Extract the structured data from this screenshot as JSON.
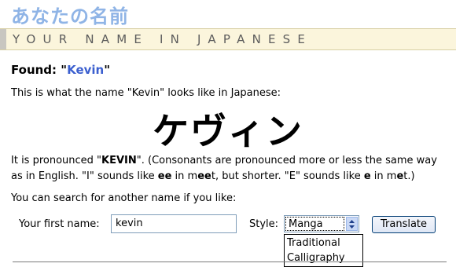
{
  "logo": "あなたの名前",
  "banner": "YOUR NAME IN JAPANESE",
  "found": {
    "prefix": "Found: ",
    "open_quote": "\"",
    "name": "Kevin",
    "close_quote": "\""
  },
  "intro": "This is what the name \"Kevin\" looks like in Japanese:",
  "kana": "ケヴィン",
  "pronunciation": {
    "p1": "It is pronounced \"",
    "name": "KEVIN",
    "p2": "\". (Consonants are pronounced more or less the same way as in English. \"I\" sounds like ",
    "ee": "ee",
    "p3": " in m",
    "ee2": "ee",
    "p4": "t, but shorter. \"E\" sounds like ",
    "e": "e",
    "p5": " in m",
    "e2": "e",
    "p6": "t.)"
  },
  "search_note": "You can search for another name if you like:",
  "form": {
    "first_name_label": "Your first name:",
    "first_name_value": "kevin",
    "style_label": "Style:",
    "style_value": "Manga",
    "style_options": [
      "Traditional",
      "Calligraphy"
    ],
    "translate_label": "Translate"
  }
}
